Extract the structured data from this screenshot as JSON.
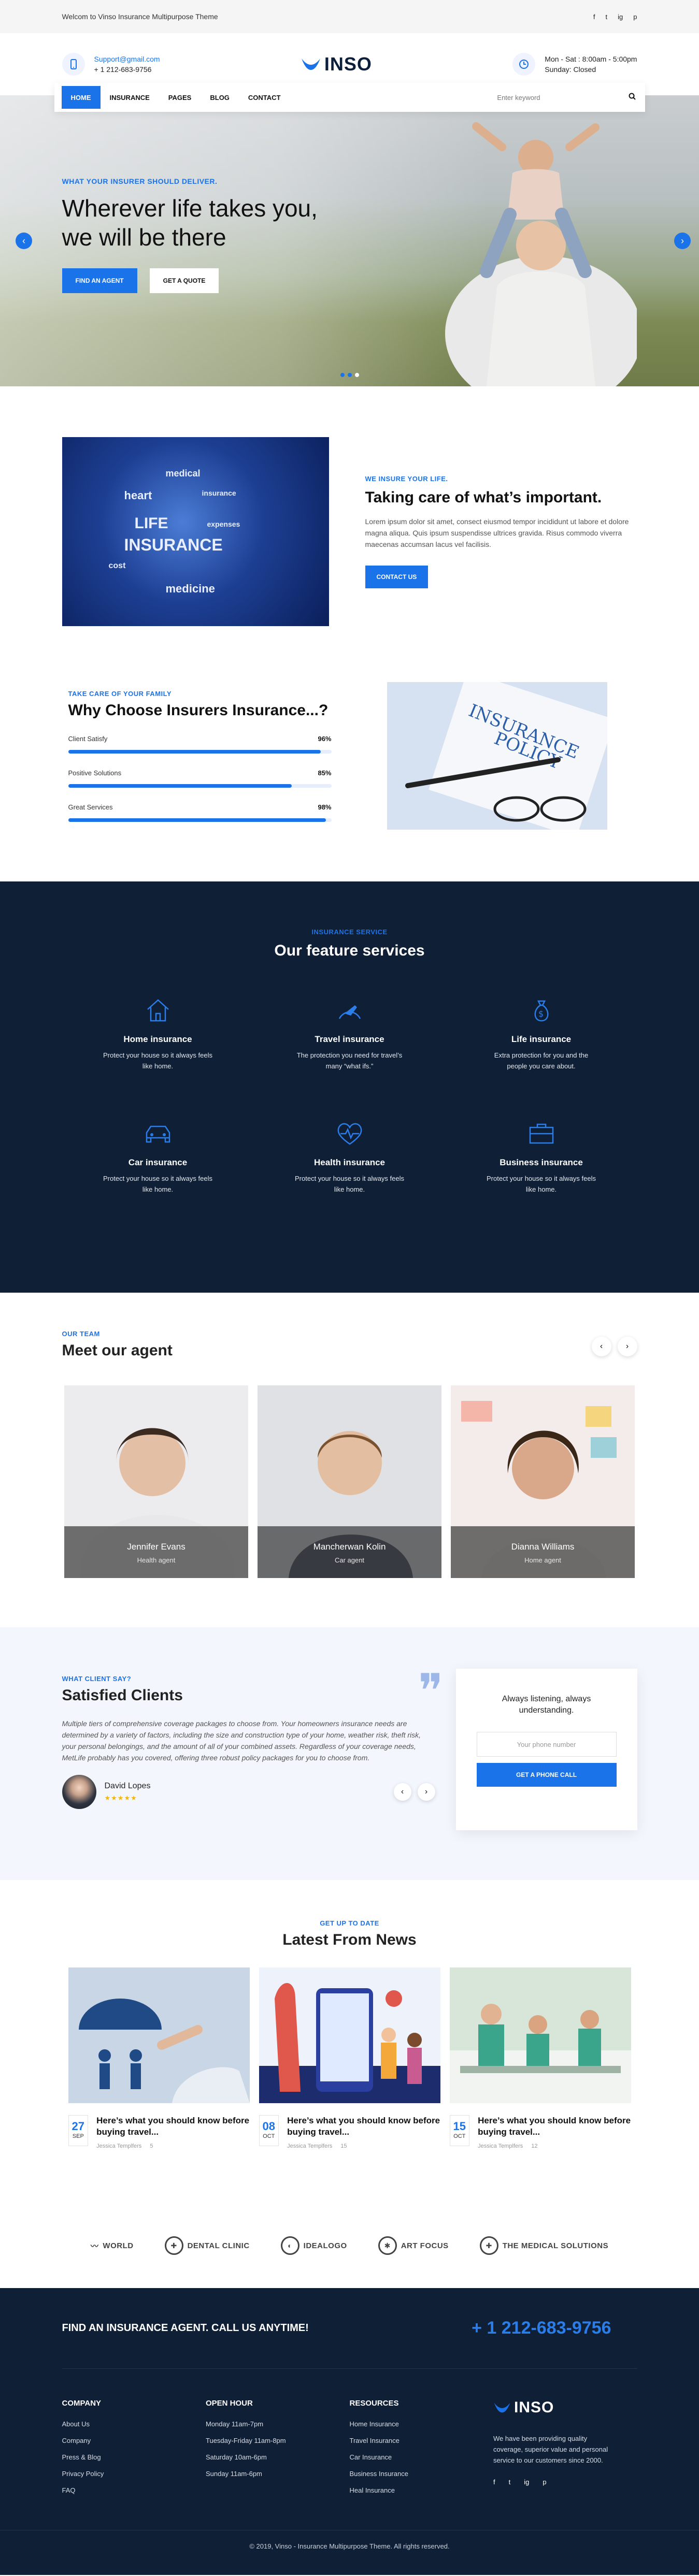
{
  "topbar": {
    "welcome": "Welcom to Vinso Insurance Multipurpose Theme",
    "social": [
      "f",
      "t",
      "ig",
      "p"
    ]
  },
  "header": {
    "email": "Support@gmail.com",
    "phone": "+ 1 212-683-9756",
    "logo": "INSO",
    "hours_line1": "Mon - Sat : 8:00am - 5:00pm",
    "hours_line2": "Sunday: Closed"
  },
  "nav": {
    "items": [
      "HOME",
      "INSURANCE",
      "PAGES",
      "BLOG",
      "CONTACT"
    ],
    "search_placeholder": "Enter keyword"
  },
  "hero": {
    "eyebrow": "WHAT YOUR INSURER SHOULD DELIVER.",
    "title_line1": "Wherever life takes you,",
    "title_line2": "we will be there",
    "btn_primary": "FIND AN AGENT",
    "btn_secondary": "GET A QUOTE"
  },
  "about": {
    "eyebrow": "WE INSURE YOUR LIFE.",
    "title": "Taking care of what’s important.",
    "body": "Lorem ipsum dolor sit amet, consect eiusmod tempor incididunt ut labore et dolore magna aliqua. Quis ipsum suspendisse ultrices gravida. Risus commodo viverra maecenas accumsan lacus vel facilisis.",
    "button": "CONTACT US"
  },
  "why": {
    "eyebrow": "TAKE CARE OF YOUR FAMILY",
    "title": "Why Choose Insurers Insurance...?",
    "bars": [
      {
        "label": "Client Satisfy",
        "value": "96%",
        "fraction": 0.96
      },
      {
        "label": "Positive Solutions",
        "value": "85%",
        "fraction": 0.85
      },
      {
        "label": "Great Services",
        "value": "98%",
        "fraction": 0.98
      }
    ]
  },
  "services": {
    "eyebrow": "INSURANCE SERVICE",
    "title": "Our feature services",
    "items": [
      {
        "title": "Home insurance",
        "desc": "Protect your house so it always feels like home.",
        "icon": "home-icon"
      },
      {
        "title": "Travel insurance",
        "desc": "The protection you need for travel’s many “what ifs.”",
        "icon": "plane-icon"
      },
      {
        "title": "Life insurance",
        "desc": "Extra protection for you and the people you care about.",
        "icon": "money-bag-icon"
      },
      {
        "title": "Car insurance",
        "desc": "Protect your house so it always feels like home.",
        "icon": "car-icon"
      },
      {
        "title": "Health insurance",
        "desc": "Protect your house so it always feels like home.",
        "icon": "heart-pulse-icon"
      },
      {
        "title": "Business insurance",
        "desc": "Protect your house so it always feels like home.",
        "icon": "briefcase-icon"
      }
    ]
  },
  "team": {
    "eyebrow": "OUR TEAM",
    "title": "Meet our agent",
    "agents": [
      {
        "name": "Jennifer Evans",
        "role": "Health agent"
      },
      {
        "name": "Mancherwan Kolin",
        "role": "Car agent"
      },
      {
        "name": "Dianna Williams",
        "role": "Home agent"
      }
    ]
  },
  "testimonials": {
    "eyebrow": "WHAT CLIENT SAY?",
    "title": "Satisfied Clients",
    "body": "Multiple tiers of comprehensive coverage packages to choose from. Your homeowners insurance needs are determined by a variety of factors, including the size and construction type of your home, weather risk, theft risk, your personal belongings, and the amount of all of your combined assets. Regardless of your coverage needs, MetLife probably has you covered, offering three robust policy packages for you to choose from.",
    "name": "David Lopes",
    "stars": "★★★★★",
    "callbox_title": "Always listening, always understanding.",
    "phone_placeholder": "Your phone number",
    "call_button": "GET A PHONE CALL"
  },
  "news": {
    "eyebrow": "GET UP TO DATE",
    "title": "Latest From News",
    "posts": [
      {
        "day": "27",
        "month": "SEP",
        "title": "Here’s what you should know before buying travel...",
        "author": "Jessica Templfers",
        "comments": "5"
      },
      {
        "day": "08",
        "month": "OCT",
        "title": "Here’s what you should know before buying travel...",
        "author": "Jessica Templfers",
        "comments": "15"
      },
      {
        "day": "15",
        "month": "OCT",
        "title": "Here’s what you should know before buying travel...",
        "author": "Jessica Templfers",
        "comments": "12"
      }
    ]
  },
  "clients": [
    "WORLD",
    "DENTAL CLINIC",
    "IDEALOGO",
    "ART FOCUS",
    "THE MEDICAL SOLUTIONS"
  ],
  "footer": {
    "cta_text": "FIND AN INSURANCE AGENT. CALL US ANYTIME!",
    "cta_phone": "+ 1 212-683-9756",
    "company_title": "COMPANY",
    "company_links": [
      "About Us",
      "Company",
      "Press & Blog",
      "Privacy Policy",
      "FAQ"
    ],
    "hours_title": "OPEN HOUR",
    "hours": [
      "Monday 11am-7pm",
      "Tuesday-Friday 11am-8pm",
      "Saturday 10am-6pm",
      "Sunday 11am-6pm"
    ],
    "resources_title": "RESOURCES",
    "resources": [
      "Home Insurance",
      "Travel Insurance",
      "Car Insurance",
      "Business Insurance",
      "Heal Insurance"
    ],
    "logo": "INSO",
    "about": "We have been providing quality coverage, superior value and personal service to our customers since 2000.",
    "social": [
      "f",
      "t",
      "ig",
      "p"
    ],
    "copyright": "© 2019, Vinso - Insurance Multipurpose Theme. All rights reserved."
  }
}
